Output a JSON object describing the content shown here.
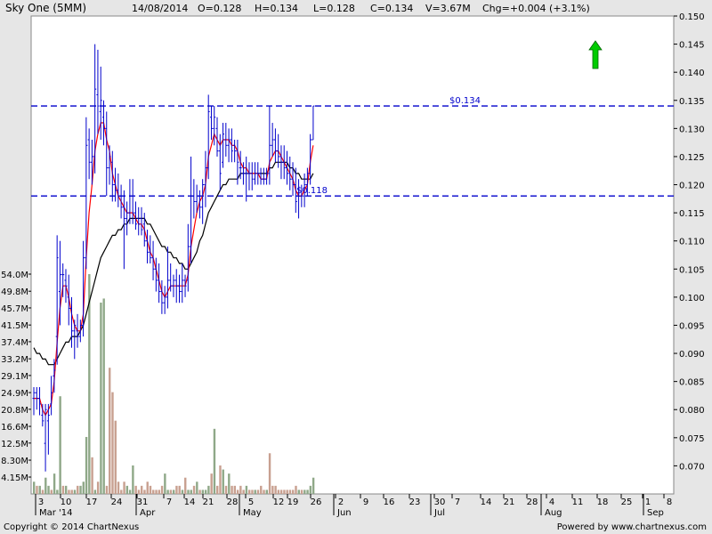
{
  "header": {
    "title": "Sky One (5MM)",
    "date": "14/08/2014",
    "open": "O=0.128",
    "high": "H=0.134",
    "low": "L=0.128",
    "close": "C=0.134",
    "volume": "V=3.67M",
    "change": "Chg=+0.004 (+3.1%)"
  },
  "footer": {
    "copyright": "Copyright © 2014 ChartNexus",
    "powered": "Powered by www.chartnexus.com"
  },
  "colors": {
    "ohlc_bars": "#0000cc",
    "ma_short": "#ff0000",
    "ma_long": "#000000",
    "resistance_line": "#0000cc",
    "volume_up": "#8fa888",
    "volume_down": "#c8a090",
    "arrow": "#00cc00",
    "plot_background": "#ffffff",
    "frame_background": "#e6e6e6"
  },
  "chart_data": {
    "type": "ohlc",
    "price_axis": {
      "side": "right",
      "ticks": [
        "0.150",
        "0.145",
        "0.140",
        "0.135",
        "0.130",
        "0.125",
        "0.120",
        "0.115",
        "0.110",
        "0.105",
        "0.100",
        "0.095",
        "0.090",
        "0.085",
        "0.080",
        "0.075",
        "0.070"
      ],
      "range": [
        0.065,
        0.15
      ]
    },
    "volume_axis": {
      "side": "left",
      "unit": "M",
      "ticks": [
        "54.0M",
        "49.8M",
        "45.7M",
        "41.5M",
        "37.4M",
        "33.2M",
        "29.1M",
        "24.9M",
        "20.8M",
        "16.6M",
        "12.5M",
        "8.30M",
        "4.15M"
      ],
      "range": [
        0,
        54.0
      ]
    },
    "x_axis": {
      "day_labels": [
        "3",
        "10",
        "17",
        "24",
        "31",
        "7",
        "14",
        "21",
        "28",
        "5",
        "12",
        "19",
        "26",
        "2",
        "9",
        "16",
        "23",
        "30",
        "7",
        "14",
        "21",
        "28",
        "4",
        "11",
        "18",
        "25",
        "1",
        "8"
      ],
      "month_labels": [
        "Mar '14",
        "Apr",
        "May",
        "Jun",
        "Jul",
        "Aug",
        "Sep"
      ]
    },
    "horizontal_lines": [
      {
        "value": 0.134,
        "label": "$0.134"
      },
      {
        "value": 0.118,
        "label": "$0.118"
      }
    ],
    "ohlc": [
      [
        0.082,
        0.084,
        0.079,
        0.083
      ],
      [
        0.083,
        0.084,
        0.08,
        0.082
      ],
      [
        0.082,
        0.084,
        0.079,
        0.081
      ],
      [
        0.079,
        0.081,
        0.077,
        0.078
      ],
      [
        0.074,
        0.081,
        0.069,
        0.08
      ],
      [
        0.078,
        0.081,
        0.072,
        0.079
      ],
      [
        0.081,
        0.086,
        0.079,
        0.083
      ],
      [
        0.086,
        0.089,
        0.083,
        0.087
      ],
      [
        0.093,
        0.111,
        0.088,
        0.107
      ],
      [
        0.101,
        0.11,
        0.095,
        0.104
      ],
      [
        0.104,
        0.106,
        0.1,
        0.104
      ],
      [
        0.103,
        0.105,
        0.099,
        0.102
      ],
      [
        0.1,
        0.104,
        0.095,
        0.098
      ],
      [
        0.098,
        0.1,
        0.091,
        0.094
      ],
      [
        0.094,
        0.096,
        0.089,
        0.095
      ],
      [
        0.094,
        0.097,
        0.091,
        0.093
      ],
      [
        0.093,
        0.096,
        0.092,
        0.095
      ],
      [
        0.095,
        0.11,
        0.093,
        0.107
      ],
      [
        0.107,
        0.132,
        0.105,
        0.127
      ],
      [
        0.128,
        0.13,
        0.121,
        0.124
      ],
      [
        0.124,
        0.128,
        0.12,
        0.125
      ],
      [
        0.125,
        0.145,
        0.122,
        0.137
      ],
      [
        0.136,
        0.144,
        0.129,
        0.134
      ],
      [
        0.133,
        0.141,
        0.128,
        0.135
      ],
      [
        0.132,
        0.135,
        0.127,
        0.13
      ],
      [
        0.13,
        0.133,
        0.118,
        0.123
      ],
      [
        0.123,
        0.127,
        0.12,
        0.125
      ],
      [
        0.124,
        0.126,
        0.117,
        0.12
      ],
      [
        0.12,
        0.123,
        0.117,
        0.119
      ],
      [
        0.119,
        0.122,
        0.116,
        0.118
      ],
      [
        0.118,
        0.12,
        0.114,
        0.116
      ],
      [
        0.116,
        0.119,
        0.105,
        0.114
      ],
      [
        0.114,
        0.117,
        0.111,
        0.115
      ],
      [
        0.115,
        0.121,
        0.113,
        0.118
      ],
      [
        0.118,
        0.121,
        0.113,
        0.115
      ],
      [
        0.115,
        0.117,
        0.112,
        0.113
      ],
      [
        0.114,
        0.116,
        0.111,
        0.113
      ],
      [
        0.114,
        0.116,
        0.111,
        0.112
      ],
      [
        0.113,
        0.115,
        0.109,
        0.11
      ],
      [
        0.11,
        0.112,
        0.106,
        0.108
      ],
      [
        0.108,
        0.111,
        0.106,
        0.107
      ],
      [
        0.107,
        0.11,
        0.103,
        0.105
      ],
      [
        0.105,
        0.107,
        0.101,
        0.103
      ],
      [
        0.103,
        0.106,
        0.099,
        0.101
      ],
      [
        0.101,
        0.103,
        0.097,
        0.099
      ],
      [
        0.099,
        0.102,
        0.097,
        0.1
      ],
      [
        0.1,
        0.109,
        0.098,
        0.103
      ],
      [
        0.103,
        0.106,
        0.101,
        0.102
      ],
      [
        0.102,
        0.104,
        0.1,
        0.103
      ],
      [
        0.103,
        0.105,
        0.099,
        0.102
      ],
      [
        0.102,
        0.104,
        0.099,
        0.101
      ],
      [
        0.101,
        0.106,
        0.099,
        0.103
      ],
      [
        0.103,
        0.104,
        0.1,
        0.102
      ],
      [
        0.103,
        0.113,
        0.101,
        0.109
      ],
      [
        0.109,
        0.125,
        0.106,
        0.118
      ],
      [
        0.118,
        0.121,
        0.114,
        0.117
      ],
      [
        0.117,
        0.12,
        0.115,
        0.118
      ],
      [
        0.118,
        0.119,
        0.114,
        0.116
      ],
      [
        0.116,
        0.121,
        0.113,
        0.12
      ],
      [
        0.12,
        0.126,
        0.116,
        0.123
      ],
      [
        0.123,
        0.136,
        0.121,
        0.133
      ],
      [
        0.132,
        0.134,
        0.128,
        0.13
      ],
      [
        0.13,
        0.134,
        0.127,
        0.132
      ],
      [
        0.13,
        0.132,
        0.125,
        0.126
      ],
      [
        0.126,
        0.129,
        0.119,
        0.122
      ],
      [
        0.124,
        0.131,
        0.123,
        0.129
      ],
      [
        0.128,
        0.131,
        0.125,
        0.127
      ],
      [
        0.127,
        0.13,
        0.124,
        0.128
      ],
      [
        0.128,
        0.13,
        0.124,
        0.126
      ],
      [
        0.127,
        0.128,
        0.124,
        0.126
      ],
      [
        0.126,
        0.128,
        0.12,
        0.124
      ],
      [
        0.123,
        0.126,
        0.121,
        0.123
      ],
      [
        0.122,
        0.124,
        0.12,
        0.122
      ],
      [
        0.122,
        0.125,
        0.117,
        0.122
      ],
      [
        0.122,
        0.124,
        0.119,
        0.122
      ],
      [
        0.122,
        0.124,
        0.119,
        0.121
      ],
      [
        0.121,
        0.124,
        0.12,
        0.122
      ],
      [
        0.122,
        0.124,
        0.12,
        0.122
      ],
      [
        0.122,
        0.123,
        0.12,
        0.121
      ],
      [
        0.121,
        0.123,
        0.12,
        0.121
      ],
      [
        0.121,
        0.123,
        0.12,
        0.122
      ],
      [
        0.122,
        0.134,
        0.12,
        0.127
      ],
      [
        0.127,
        0.131,
        0.125,
        0.128
      ],
      [
        0.128,
        0.13,
        0.124,
        0.126
      ],
      [
        0.126,
        0.129,
        0.123,
        0.125
      ],
      [
        0.125,
        0.127,
        0.121,
        0.124
      ],
      [
        0.124,
        0.127,
        0.121,
        0.123
      ],
      [
        0.123,
        0.126,
        0.12,
        0.122
      ],
      [
        0.122,
        0.125,
        0.119,
        0.121
      ],
      [
        0.121,
        0.124,
        0.118,
        0.12
      ],
      [
        0.12,
        0.123,
        0.115,
        0.117
      ],
      [
        0.118,
        0.121,
        0.114,
        0.118
      ],
      [
        0.118,
        0.12,
        0.116,
        0.118
      ],
      [
        0.118,
        0.122,
        0.116,
        0.12
      ],
      [
        0.12,
        0.123,
        0.118,
        0.122
      ],
      [
        0.122,
        0.129,
        0.12,
        0.128
      ],
      [
        0.128,
        0.134,
        0.128,
        0.134
      ]
    ],
    "ma_short": [
      0.082,
      0.082,
      0.082,
      0.08,
      0.079,
      0.08,
      0.081,
      0.085,
      0.092,
      0.098,
      0.102,
      0.102,
      0.1,
      0.097,
      0.095,
      0.094,
      0.094,
      0.097,
      0.107,
      0.115,
      0.12,
      0.126,
      0.129,
      0.131,
      0.131,
      0.128,
      0.126,
      0.122,
      0.12,
      0.118,
      0.117,
      0.116,
      0.115,
      0.115,
      0.115,
      0.114,
      0.113,
      0.113,
      0.112,
      0.11,
      0.108,
      0.107,
      0.105,
      0.103,
      0.101,
      0.1,
      0.101,
      0.102,
      0.102,
      0.102,
      0.102,
      0.102,
      0.102,
      0.104,
      0.109,
      0.112,
      0.115,
      0.117,
      0.118,
      0.12,
      0.125,
      0.127,
      0.129,
      0.128,
      0.127,
      0.128,
      0.128,
      0.128,
      0.127,
      0.127,
      0.126,
      0.124,
      0.123,
      0.123,
      0.122,
      0.122,
      0.122,
      0.122,
      0.121,
      0.121,
      0.121,
      0.124,
      0.125,
      0.126,
      0.126,
      0.125,
      0.124,
      0.123,
      0.122,
      0.121,
      0.119,
      0.118,
      0.118,
      0.119,
      0.12,
      0.124,
      0.127
    ],
    "ma_long": [
      0.091,
      0.09,
      0.09,
      0.089,
      0.089,
      0.088,
      0.088,
      0.088,
      0.089,
      0.09,
      0.091,
      0.092,
      0.092,
      0.093,
      0.093,
      0.093,
      0.094,
      0.095,
      0.097,
      0.099,
      0.101,
      0.103,
      0.105,
      0.107,
      0.108,
      0.109,
      0.11,
      0.111,
      0.111,
      0.112,
      0.112,
      0.113,
      0.113,
      0.114,
      0.114,
      0.114,
      0.114,
      0.114,
      0.114,
      0.113,
      0.113,
      0.112,
      0.111,
      0.11,
      0.109,
      0.109,
      0.108,
      0.108,
      0.107,
      0.107,
      0.106,
      0.106,
      0.105,
      0.105,
      0.106,
      0.107,
      0.108,
      0.11,
      0.111,
      0.113,
      0.115,
      0.116,
      0.117,
      0.118,
      0.119,
      0.12,
      0.12,
      0.121,
      0.121,
      0.121,
      0.121,
      0.122,
      0.122,
      0.122,
      0.122,
      0.122,
      0.122,
      0.122,
      0.122,
      0.122,
      0.122,
      0.123,
      0.123,
      0.124,
      0.124,
      0.124,
      0.124,
      0.124,
      0.123,
      0.123,
      0.122,
      0.122,
      0.121,
      0.121,
      0.121,
      0.121,
      0.122
    ],
    "volume": [
      3,
      2,
      2,
      1,
      4,
      2,
      1,
      5,
      1,
      24,
      2,
      2,
      1,
      1,
      1,
      2,
      2,
      3,
      14,
      54,
      9,
      1,
      3,
      47,
      48,
      2,
      31,
      25,
      18,
      3,
      1,
      3,
      2,
      1,
      7,
      2,
      1,
      2,
      1,
      3,
      2,
      1,
      1,
      1,
      2,
      5,
      1,
      1,
      1,
      2,
      2,
      1,
      4,
      1,
      1,
      2,
      3,
      1,
      1,
      1,
      2,
      5,
      16,
      2,
      7,
      6,
      2,
      5,
      2,
      2,
      1,
      2,
      1,
      2,
      1,
      1,
      1,
      1,
      2,
      1,
      1,
      10,
      2,
      2,
      1,
      1,
      1,
      1,
      1,
      1,
      2,
      1,
      1,
      1,
      1,
      2,
      4
    ],
    "volume_up": [
      true,
      false,
      true,
      false,
      true,
      true,
      false,
      true,
      true,
      true,
      false,
      true,
      false,
      false,
      true,
      false,
      true,
      true,
      true,
      true,
      false,
      true,
      false,
      true,
      true,
      false,
      false,
      false,
      false,
      false,
      false,
      false,
      true,
      true,
      true,
      false,
      false,
      false,
      false,
      false,
      false,
      false,
      false,
      false,
      false,
      true,
      true,
      false,
      true,
      false,
      false,
      true,
      false,
      true,
      true,
      false,
      true,
      false,
      true,
      true,
      true,
      false,
      true,
      false,
      false,
      true,
      false,
      true,
      false,
      false,
      false,
      false,
      false,
      true,
      false,
      false,
      true,
      false,
      false,
      false,
      true,
      false,
      false,
      false,
      false,
      false,
      false,
      false,
      false,
      false,
      false,
      true,
      false,
      true,
      true,
      true,
      true
    ]
  }
}
